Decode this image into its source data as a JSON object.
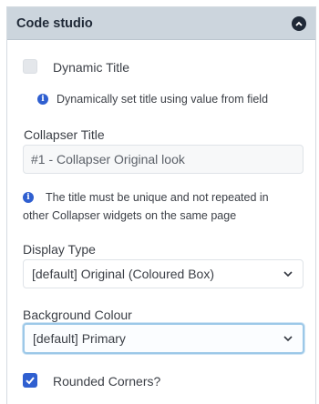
{
  "panel": {
    "title": "Code studio",
    "collapse_icon": "chevron-up-circle-icon"
  },
  "dynamic_title": {
    "label": "Dynamic Title",
    "checked": false,
    "help": "Dynamically set title using value from field"
  },
  "collapser_title": {
    "label": "Collapser Title",
    "value": "#1 - Collapser Original look",
    "help_line1": "The title must be unique and not repeated in",
    "help_line2": "other Collapser widgets on the same page"
  },
  "display_type": {
    "label": "Display Type",
    "value": "[default] Original (Coloured Box)"
  },
  "background_colour": {
    "label": "Background Colour",
    "value": "[default] Primary"
  },
  "rounded_corners": {
    "label": "Rounded Corners?",
    "checked": true
  },
  "colors": {
    "accent": "#2f5fd0",
    "header_bg": "#ccd5dd",
    "focus_ring": "#9cc8e8"
  }
}
